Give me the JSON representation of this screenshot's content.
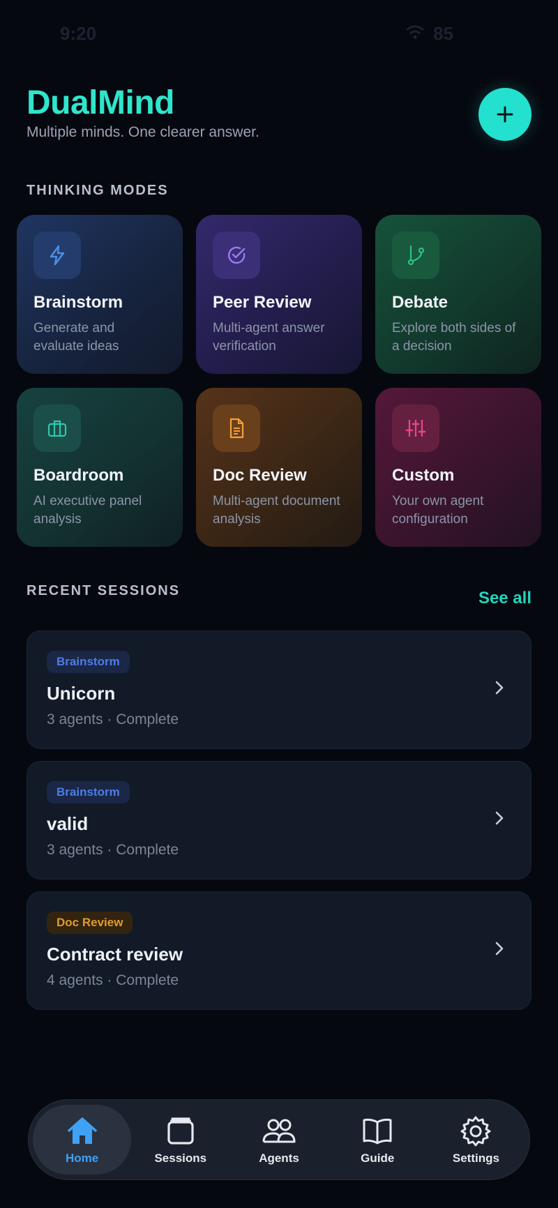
{
  "status_bar": {
    "time": "9:20",
    "location_icon": "location-arrow-icon",
    "wifi_icon": "wifi-icon",
    "battery": "85"
  },
  "header": {
    "title": "DualMind",
    "tagline": "Multiple minds. One clearer answer.",
    "fab_icon": "plus-icon",
    "accent_color": "#2ee6cc"
  },
  "modes_section": {
    "title": "THINKING MODES",
    "items": [
      {
        "name": "Brainstorm",
        "desc": "Generate and evaluate ideas",
        "icon": "lightning-icon",
        "color": "#4d8fe8"
      },
      {
        "name": "Peer Review",
        "desc": "Multi-agent answer verification",
        "icon": "check-circle-icon",
        "color": "#9a7cf0"
      },
      {
        "name": "Debate",
        "desc": "Explore both sides of a decision",
        "icon": "git-branch-icon",
        "color": "#2fc27b"
      },
      {
        "name": "Boardroom",
        "desc": "AI executive panel analysis",
        "icon": "briefcase-icon",
        "color": "#2cc9ad"
      },
      {
        "name": "Doc Review",
        "desc": "Multi-agent document analysis",
        "icon": "document-icon",
        "color": "#f2a23a"
      },
      {
        "name": "Custom",
        "desc": "Your own agent configuration",
        "icon": "sliders-icon",
        "color": "#e8478d"
      }
    ]
  },
  "sessions_section": {
    "title": "RECENT SESSIONS",
    "see_all": "See all",
    "items": [
      {
        "badge": "Brainstorm",
        "title": "Unicorn",
        "meta": "3 agents · Complete"
      },
      {
        "badge": "Brainstorm",
        "title": "valid",
        "meta": "3 agents · Complete"
      },
      {
        "badge": "Doc Review",
        "title": "Contract review",
        "meta": "4 agents · Complete"
      }
    ]
  },
  "tabbar": {
    "items": [
      {
        "label": "Home",
        "icon": "home-icon",
        "active": true
      },
      {
        "label": "Sessions",
        "icon": "archive-icon",
        "active": false
      },
      {
        "label": "Agents",
        "icon": "users-icon",
        "active": false
      },
      {
        "label": "Guide",
        "icon": "book-icon",
        "active": false
      },
      {
        "label": "Settings",
        "icon": "gear-icon",
        "active": false
      }
    ]
  }
}
